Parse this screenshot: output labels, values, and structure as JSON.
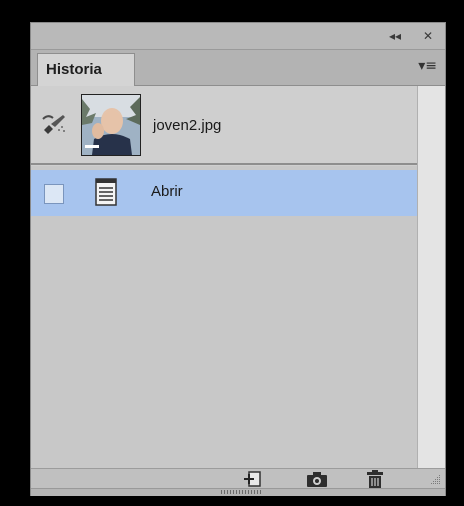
{
  "panel": {
    "controls": {
      "collapse": "◂◂",
      "close": "✕"
    },
    "tab_label": "Historia",
    "menu_glyph": "▾≡"
  },
  "history": {
    "snapshot": {
      "label": "joven2.jpg",
      "icon": "history-brush-icon"
    },
    "states": [
      {
        "label": "Abrir",
        "icon": "document-icon",
        "selected": true
      }
    ]
  },
  "toolbar": {
    "buttons": [
      {
        "name": "new-document-from-state",
        "icon": "new-document-icon"
      },
      {
        "name": "new-snapshot",
        "icon": "camera-icon"
      },
      {
        "name": "delete-state",
        "icon": "trash-icon"
      }
    ]
  },
  "colors": {
    "selection": "#a7c4ee",
    "panel_bg": "#c8c8c8"
  }
}
